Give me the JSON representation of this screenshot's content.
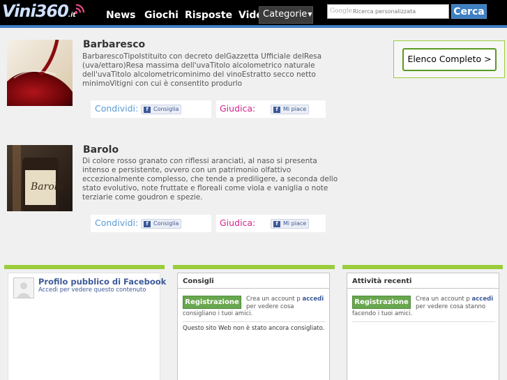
{
  "header": {
    "logo_text": "Vini360",
    "logo_ext": ".it",
    "nav": [
      "News",
      "Giochi",
      "Risposte",
      "Vide"
    ],
    "categories_label": "Categorie",
    "search_placeholder": "Ricerca personalizzata",
    "search_brand": "Google",
    "search_button": "Cerca"
  },
  "articles": [
    {
      "title": "Barbaresco",
      "description": "BarbarescoTipoIstituito con decreto delGazzetta Ufficiale delResa (uva/ettaro)Resa massima dell'uvaTitolo alcolometrico naturale dell'uvaTitolo alcolometricominimo del vinoEstratto secco netto minimoVitigni con cui è consentito produrlo",
      "share_label": "Condividi:",
      "share_button": "Consiglia",
      "rate_label": "Giudica:",
      "rate_button": "Mi piace"
    },
    {
      "title": "Barolo",
      "description": "Di colore rosso granato con riflessi aranciati, al naso si presenta intenso e persistente, ovvero con un patrimonio olfattivo eccezionalmente complesso, che tende a prediligere, a seconda dello stato evolutivo, note fruttate e floreali come viola e vaniglia o note terziarie come goudron e spezie.",
      "share_label": "Condividi:",
      "share_button": "Consiglia",
      "rate_label": "Giudica:",
      "rate_button": "Mi piace"
    }
  ],
  "elenco_button": "Elenco Completo >",
  "widgets": {
    "profile": {
      "title": "Profilo pubblico di Facebook",
      "subtitle": "Accedi per vedere questo contenuto"
    },
    "consigli": {
      "heading": "Consigli",
      "register": "Registrazione",
      "text_a": "Crea un account p",
      "login": "accedi",
      "text_b": "per vedere cosa",
      "text_c": "consigliano i tuoi amici.",
      "note": "Questo sito Web non è stato ancora consigliato."
    },
    "attivita": {
      "heading": "Attività recenti",
      "register": "Registrazione",
      "text_a": "Crea un account p",
      "login": "accedi",
      "text_b": "per vedere cosa stanno",
      "text_c": "facendo i tuoi amici."
    }
  },
  "colors": {
    "accent_blue": "#3d7fc2",
    "share_blue": "#5a9ad6",
    "rate_magenta": "#d4248c",
    "facebook_blue": "#3b5998",
    "green": "#9acd3a",
    "register_green": "#69a74e"
  },
  "icons": [
    "wifi-signal-icon",
    "caret-down-icon",
    "facebook-f-icon",
    "profile-placeholder-icon"
  ]
}
